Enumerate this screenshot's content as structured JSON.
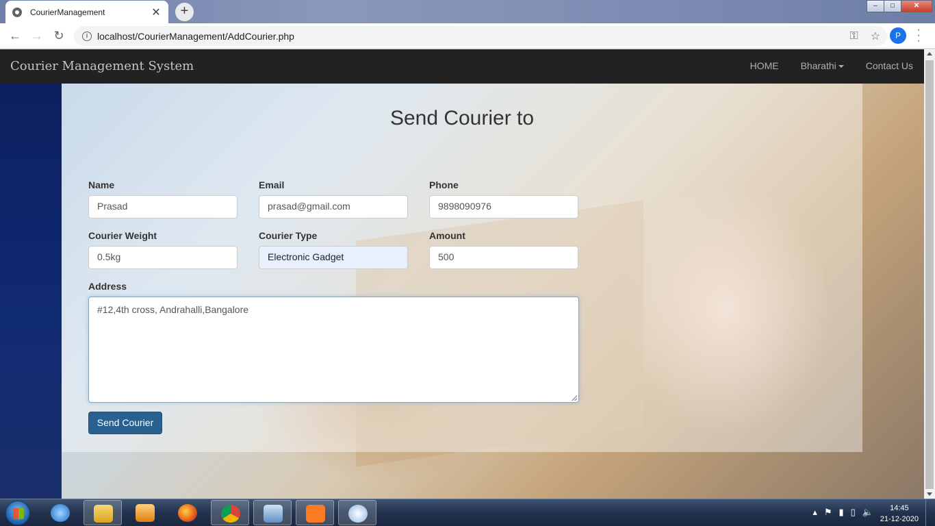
{
  "browser": {
    "tab_title": "CourierManagement",
    "tab_close": "✕",
    "new_tab": "+",
    "url": "localhost/CourierManagement/AddCourier.php",
    "profile_initial": "P",
    "window_controls": {
      "minimize": "–",
      "maximize": "□",
      "close": "✕"
    }
  },
  "navbar": {
    "brand": "Courier Management System",
    "links": {
      "home": "HOME",
      "user": "Bharathi",
      "contact": "Contact Us"
    }
  },
  "form": {
    "heading": "Send Courier to",
    "name": {
      "label": "Name",
      "value": "Prasad"
    },
    "email": {
      "label": "Email",
      "value": "prasad@gmail.com"
    },
    "phone": {
      "label": "Phone",
      "value": "9898090976"
    },
    "weight": {
      "label": "Courier Weight",
      "value": "0.5kg"
    },
    "type": {
      "label": "Courier Type",
      "value": "Electronic Gadget"
    },
    "amount": {
      "label": "Amount",
      "value": "500"
    },
    "address": {
      "label": "Address",
      "value": "#12,4th cross, Andrahalli,Bangalore"
    },
    "submit_label": "Send Courier"
  },
  "taskbar": {
    "time": "14:45",
    "date": "21-12-2020",
    "apps": [
      "internet-explorer",
      "file-explorer",
      "media-player",
      "firefox",
      "chrome",
      "remote-desktop",
      "xampp",
      "paint"
    ]
  },
  "colors": {
    "navbar_bg": "#222222",
    "button_bg": "#286090",
    "autofill_bg": "#e8f0fe"
  }
}
